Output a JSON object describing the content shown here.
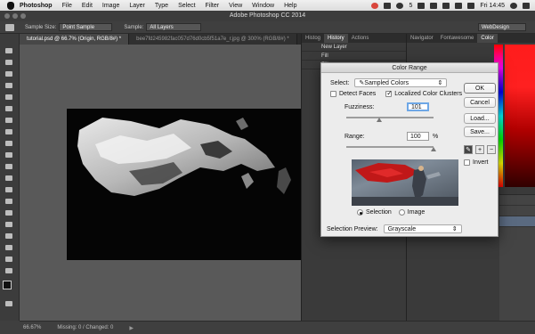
{
  "menubar": {
    "app": "Photoshop",
    "items": [
      "File",
      "Edit",
      "Image",
      "Layer",
      "Type",
      "Select",
      "Filter",
      "View",
      "Window",
      "Help"
    ],
    "clock": "Fri 14:45",
    "badge": "5"
  },
  "window": {
    "title": "Adobe Photoshop CC 2014"
  },
  "options": {
    "sample_size_label": "Sample Size:",
    "sample_size_value": "Point Sample",
    "sample_label": "Sample:",
    "sample_value": "All Layers",
    "workspace": "WebDesign"
  },
  "tabs": [
    {
      "label": "tutorial.psd @ 66.7% (Origin, RGB/8#) *"
    },
    {
      "label": "bee7fd245982fac057d76d0cb5f51a7e_r.jpg @ 300% (RGB/8#) *"
    }
  ],
  "panels": {
    "left_tabs": [
      "Histog",
      "History",
      "Actions"
    ],
    "history_items": [
      "New Layer",
      "Fill",
      "Fill"
    ],
    "right_tabs": [
      "Navigator",
      "Fontawesome",
      "Color"
    ]
  },
  "dialog": {
    "title": "Color Range",
    "select_label": "Select:",
    "select_value": "Sampled Colors",
    "detect_faces": "Detect Faces",
    "localized": "Localized Color Clusters",
    "fuzziness_label": "Fuzziness:",
    "fuzziness_value": "101",
    "fuzziness_level": 0.38,
    "range_label": "Range:",
    "range_value": "100",
    "range_unit": "%",
    "range_level": 1.0,
    "selection_label": "Selection",
    "image_label": "Image",
    "preview_label": "Selection Preview:",
    "preview_value": "Grayscale",
    "ok": "OK",
    "cancel": "Cancel",
    "load": "Load...",
    "save": "Save...",
    "invert": "Invert"
  },
  "status": {
    "zoom": "66.67%",
    "missing": "Missing: 0 / Changed: 0"
  }
}
